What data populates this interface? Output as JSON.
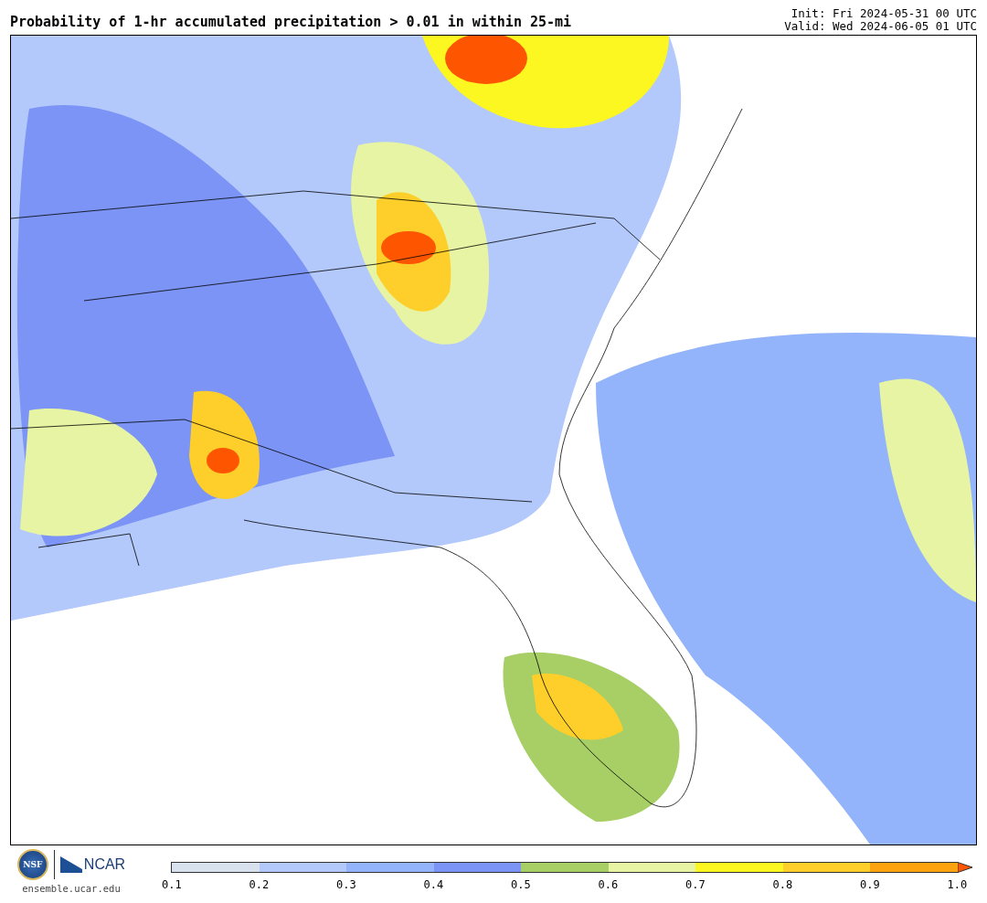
{
  "title": "Probability of 1-hr accumulated precipitation > 0.01 in within 25-mi",
  "init": "Init: Fri 2024-05-31 00 UTC",
  "valid": "Valid: Wed 2024-06-05 01 UTC",
  "footer": {
    "logo_left": "NSF",
    "logo_right": "NCAR",
    "website": "ensemble.ucar.edu"
  },
  "colorbar": {
    "bins": [
      {
        "color": "#d8e2ef"
      },
      {
        "color": "#b3c8fb"
      },
      {
        "color": "#93b3fb"
      },
      {
        "color": "#7b94f5"
      },
      {
        "color": "#a7cf66"
      },
      {
        "color": "#e7f4a4"
      },
      {
        "color": "#fdf721"
      },
      {
        "color": "#fecf2a"
      },
      {
        "color": "#fda30f"
      }
    ],
    "extend": {
      "color": "#fe5500"
    },
    "ticks": [
      "0.1",
      "0.2",
      "0.3",
      "0.4",
      "0.5",
      "0.6",
      "0.7",
      "0.8",
      "0.9",
      "1.0"
    ]
  }
}
